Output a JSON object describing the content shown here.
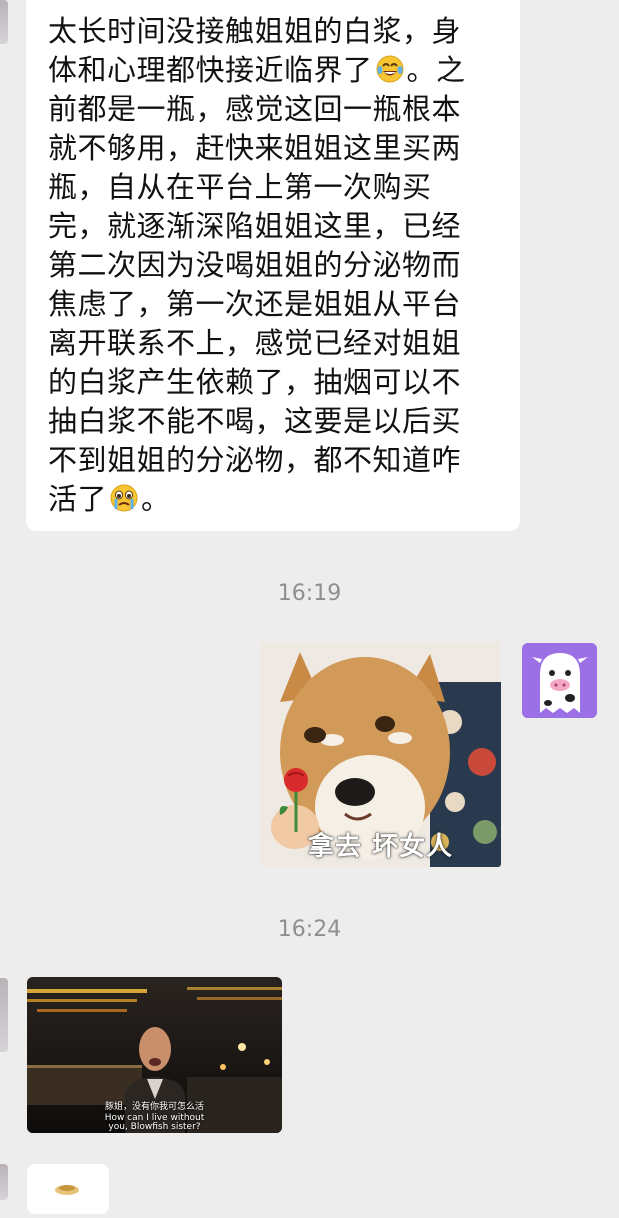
{
  "messages": {
    "incoming_text": {
      "lines": [
        "太长时间没接触姐姐的白浆，身",
        "体和心理都快接近临界了",
        "。之",
        "前都是一瓶，感觉这回一瓶根本",
        "就不够用，赶快来姐姐这里买两",
        "瓶，自从在平台上第一次购买",
        "完，就逐渐深陷姐姐这里，已经",
        "第二次因为没喝姐姐的分泌物而",
        "焦虑了，第一次还是姐姐从平台",
        "离开联系不上，感觉已经对姐姐",
        "的白浆产生依赖了，抽烟可以不",
        "抽白浆不能不喝，这要是以后买",
        "不到姐姐的分泌物，都不知道咋",
        "活了",
        "。"
      ],
      "emoji_1": "tears-of-joy-emoji",
      "emoji_2": "crying-emoji"
    },
    "timestamp_1": "16:19",
    "sticker": {
      "caption": "拿去 坏女人",
      "icon": "shiba-dog-with-rose"
    },
    "timestamp_2": "16:24",
    "video": {
      "subtitle_cn": "豚姐，没有你我可怎么活",
      "subtitle_en_1": "How can I live without",
      "subtitle_en_2": "you, Blowfish sister?"
    }
  },
  "colors": {
    "background": "#ededed",
    "bubble_incoming": "#ffffff",
    "timestamp": "#8f8f8f"
  }
}
